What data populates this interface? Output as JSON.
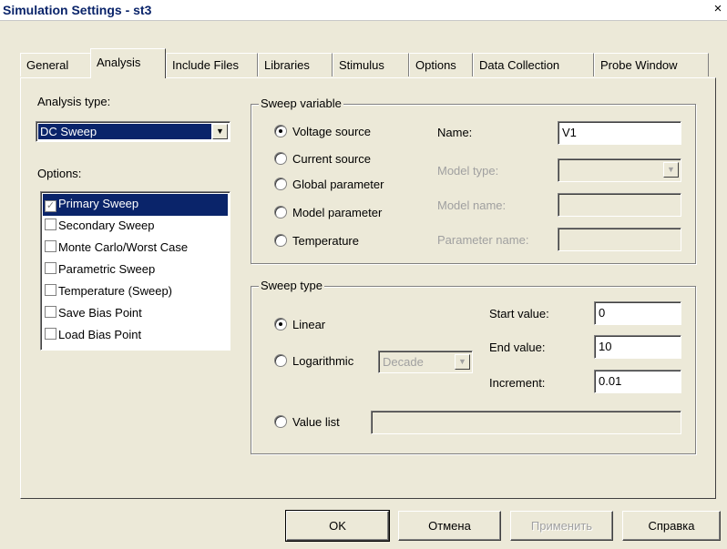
{
  "window": {
    "title": "Simulation Settings - st3",
    "close_glyph": "×"
  },
  "tabs": [
    {
      "label": "General",
      "active": false
    },
    {
      "label": "Analysis",
      "active": true
    },
    {
      "label": "Include Files",
      "active": false
    },
    {
      "label": "Libraries",
      "active": false
    },
    {
      "label": "Stimulus",
      "active": false
    },
    {
      "label": "Options",
      "active": false
    },
    {
      "label": "Data Collection",
      "active": false
    },
    {
      "label": "Probe Window",
      "active": false
    }
  ],
  "analysis": {
    "type_label": "Analysis type:",
    "type_value": "DC Sweep",
    "options_label": "Options:",
    "options": [
      {
        "label": "Primary Sweep",
        "checked": true,
        "selected": true
      },
      {
        "label": "Secondary Sweep",
        "checked": false,
        "selected": false
      },
      {
        "label": "Monte Carlo/Worst Case",
        "checked": false,
        "selected": false
      },
      {
        "label": "Parametric Sweep",
        "checked": false,
        "selected": false
      },
      {
        "label": "Temperature (Sweep)",
        "checked": false,
        "selected": false
      },
      {
        "label": "Save Bias Point",
        "checked": false,
        "selected": false
      },
      {
        "label": "Load Bias Point",
        "checked": false,
        "selected": false
      }
    ]
  },
  "sweep_variable": {
    "legend": "Sweep variable",
    "radios": [
      {
        "label": "Voltage source",
        "checked": true
      },
      {
        "label": "Current source",
        "checked": false
      },
      {
        "label": "Global parameter",
        "checked": false
      },
      {
        "label": "Model parameter",
        "checked": false
      },
      {
        "label": "Temperature",
        "checked": false
      }
    ],
    "name_label": "Name:",
    "name_value": "V1",
    "model_type_label": "Model type:",
    "model_name_label": "Model name:",
    "parameter_name_label": "Parameter name:"
  },
  "sweep_type": {
    "legend": "Sweep type",
    "linear_label": "Linear",
    "logarithmic_label": "Logarithmic",
    "log_scale_value": "Decade",
    "value_list_label": "Value list",
    "selected": "Linear",
    "start_label": "Start value:",
    "start_value": "0",
    "end_label": "End value:",
    "end_value": "10",
    "increment_label": "Increment:",
    "increment_value": "0.01"
  },
  "buttons": {
    "ok": "OK",
    "cancel": "Отмена",
    "apply": "Применить",
    "help": "Справка"
  }
}
